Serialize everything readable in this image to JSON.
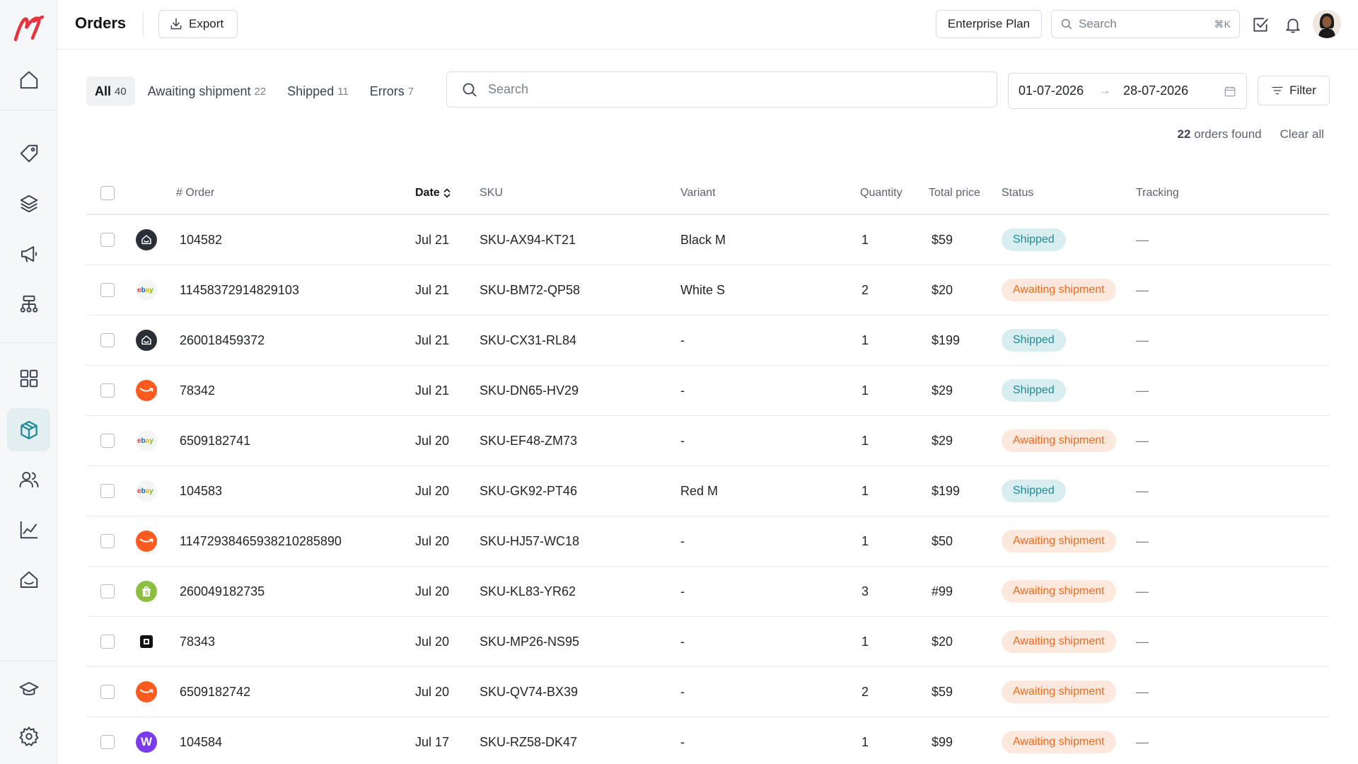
{
  "header": {
    "title": "Orders",
    "export_label": "Export",
    "plan_label": "Enterprise Plan",
    "search_placeholder": "Search",
    "search_shortcut": "⌘K"
  },
  "sidebar": {
    "items": [
      {
        "icon": "home-icon"
      },
      {
        "icon": "tag-icon"
      },
      {
        "icon": "layers-icon"
      },
      {
        "icon": "megaphone-icon"
      },
      {
        "icon": "sitemap-icon"
      },
      {
        "icon": "grid-icon"
      },
      {
        "icon": "package-icon",
        "active": true
      },
      {
        "icon": "users-icon"
      },
      {
        "icon": "chart-icon"
      },
      {
        "icon": "inbox-icon"
      },
      {
        "icon": "graduation-cap-icon"
      },
      {
        "icon": "gear-icon"
      }
    ]
  },
  "filters": {
    "tabs": [
      {
        "label": "All",
        "count": "40",
        "active": true
      },
      {
        "label": "Awaiting shipment",
        "count": "22"
      },
      {
        "label": "Shipped",
        "count": "11"
      },
      {
        "label": "Errors",
        "count": "7"
      }
    ],
    "search_placeholder": "Search",
    "date_from": "01-07-2026",
    "date_to": "28-07-2026",
    "filter_label": "Filter",
    "results_count": "22",
    "results_text": "orders found",
    "clear_label": "Clear all"
  },
  "table": {
    "columns": {
      "order": "# Order",
      "date": "Date",
      "sku": "SKU",
      "variant": "Variant",
      "quantity": "Quantity",
      "total": "Total price",
      "status": "Status",
      "tracking": "Tracking"
    },
    "rows": [
      {
        "channel": "inbox",
        "order": "104582",
        "date": "Jul 21",
        "sku": "SKU-AX94-KT21",
        "variant": "Black M",
        "qty": "1",
        "total": "$59",
        "status": "Shipped",
        "status_type": "shipped",
        "tracking": "—"
      },
      {
        "channel": "ebay",
        "order": "11458372914829103",
        "date": "Jul 21",
        "sku": "SKU-BM72-QP58",
        "variant": "White S",
        "qty": "2",
        "total": "$20",
        "status": "Awaiting shipment",
        "status_type": "awaiting",
        "tracking": "—"
      },
      {
        "channel": "inbox",
        "order": "260018459372",
        "date": "Jul 21",
        "sku": "SKU-CX31-RL84",
        "variant": "-",
        "qty": "1",
        "total": "$199",
        "status": "Shipped",
        "status_type": "shipped",
        "tracking": "—"
      },
      {
        "channel": "amazon",
        "order": "78342",
        "date": "Jul 21",
        "sku": "SKU-DN65-HV29",
        "variant": "-",
        "qty": "1",
        "total": "$29",
        "status": "Shipped",
        "status_type": "shipped",
        "tracking": "—"
      },
      {
        "channel": "ebay",
        "order": "6509182741",
        "date": "Jul 20",
        "sku": "SKU-EF48-ZM73",
        "variant": "-",
        "qty": "1",
        "total": "$29",
        "status": "Awaiting shipment",
        "status_type": "awaiting",
        "tracking": "—"
      },
      {
        "channel": "ebay",
        "order": "104583",
        "date": "Jul 20",
        "sku": "SKU-GK92-PT46",
        "variant": "Red M",
        "qty": "1",
        "total": "$199",
        "status": "Shipped",
        "status_type": "shipped",
        "tracking": "—"
      },
      {
        "channel": "amazon",
        "order": "11472938465938210285890",
        "date": "Jul 20",
        "sku": "SKU-HJ57-WC18",
        "variant": "-",
        "qty": "1",
        "total": "$50",
        "status": "Awaiting shipment",
        "status_type": "awaiting",
        "tracking": "—"
      },
      {
        "channel": "shopify",
        "order": "260049182735",
        "date": "Jul 20",
        "sku": "SKU-KL83-YR62",
        "variant": "-",
        "qty": "3",
        "total": "#99",
        "status": "Awaiting shipment",
        "status_type": "awaiting",
        "tracking": "—"
      },
      {
        "channel": "square",
        "order": "78343",
        "date": "Jul 20",
        "sku": "SKU-MP26-NS95",
        "variant": "-",
        "qty": "1",
        "total": "$20",
        "status": "Awaiting shipment",
        "status_type": "awaiting",
        "tracking": "—"
      },
      {
        "channel": "amazon",
        "order": "6509182742",
        "date": "Jul 20",
        "sku": "SKU-QV74-BX39",
        "variant": "-",
        "qty": "2",
        "total": "$59",
        "status": "Awaiting shipment",
        "status_type": "awaiting",
        "tracking": "—"
      },
      {
        "channel": "woo",
        "order": "104584",
        "date": "Jul 17",
        "sku": "SKU-RZ58-DK47",
        "variant": "-",
        "qty": "1",
        "total": "$99",
        "status": "Awaiting shipment",
        "status_type": "awaiting",
        "tracking": "—"
      }
    ]
  },
  "colors": {
    "accent": "#1e8a96",
    "shipped_bg": "#d8edf0",
    "awaiting_bg": "#fde8dd",
    "awaiting_text": "#ee6a1f",
    "brand": "#e6333f"
  }
}
